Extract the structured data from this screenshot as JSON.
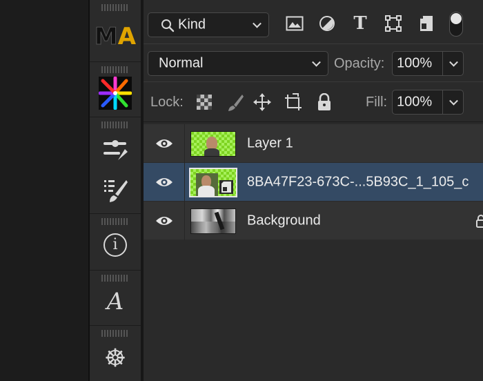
{
  "toolstrip": {
    "tools": [
      {
        "name": "ma-plugin",
        "text_m": "M",
        "text_a": "A"
      },
      {
        "name": "color-star-plugin"
      },
      {
        "name": "adjustments-tool"
      },
      {
        "name": "brush-list-tool"
      },
      {
        "name": "info-tool",
        "glyph": "i"
      },
      {
        "name": "glyphs-tool",
        "glyph": "A"
      },
      {
        "name": "ship-wheel-tool",
        "glyph": "☸"
      }
    ]
  },
  "filter_bar": {
    "kind_label": "Kind",
    "icons": [
      "image-filter-icon",
      "adjustment-filter-icon",
      "type-filter-icon",
      "shape-filter-icon",
      "smart-object-filter-icon",
      "filter-toggle-icon"
    ],
    "type_glyph": "T"
  },
  "blend_bar": {
    "blend_mode": "Normal",
    "opacity_label": "Opacity:",
    "opacity_value": "100%"
  },
  "lock_bar": {
    "lock_label": "Lock:",
    "fill_label": "Fill:",
    "fill_value": "100%",
    "icons": [
      "lock-transparent-icon",
      "lock-paint-icon",
      "lock-position-icon",
      "lock-artboard-icon",
      "lock-all-icon"
    ]
  },
  "layers": [
    {
      "name": "Layer 1",
      "selected": false,
      "thumb": "green-checker-face"
    },
    {
      "name": "8BA47F23-673C-...5B93C_1_105_c",
      "selected": true,
      "thumb": "smart-object"
    },
    {
      "name": "Background",
      "selected": false,
      "thumb": "bw-photo",
      "locked": true
    }
  ],
  "colors": {
    "panel_bg": "#2a2a2a",
    "selected_row": "#344a64",
    "layer_row": "#333333",
    "thumb_green": "#7ed321"
  }
}
